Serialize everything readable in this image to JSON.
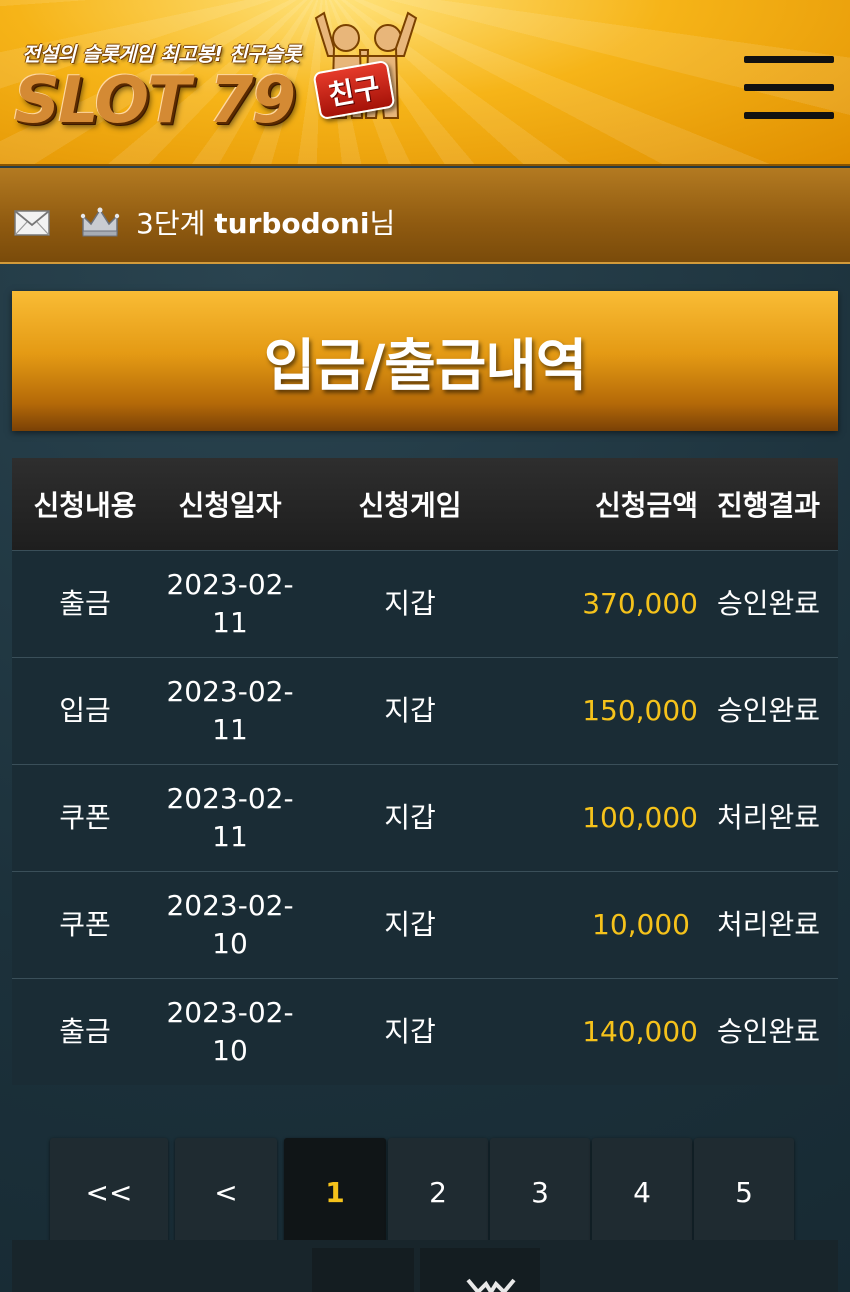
{
  "header": {
    "tagline": "전설의 슬롯게임 최고봉! 친구슬롯",
    "logo_text": "SLOT 79",
    "logo_badge": "친구",
    "menu_icon": "hamburger-menu-icon",
    "colors": {
      "primary": "#f6b418",
      "dark": "#8a5500"
    }
  },
  "userbar": {
    "mail_icon": "mail-icon",
    "crown_icon": "crown-icon",
    "level": "3단계",
    "username": "turbodoni",
    "suffix": "님"
  },
  "title": "입금/출금내역",
  "table": {
    "headers": [
      "신청내용",
      "신청일자",
      "신청게임",
      "신청금액",
      "진행결과"
    ],
    "rows": [
      {
        "type": "출금",
        "date_1": "2023-02-",
        "date_2": "11",
        "game": "지갑",
        "amount": "370,000",
        "result": "승인완료"
      },
      {
        "type": "입금",
        "date_1": "2023-02-",
        "date_2": "11",
        "game": "지갑",
        "amount": "150,000",
        "result": "승인완료"
      },
      {
        "type": "쿠폰",
        "date_1": "2023-02-",
        "date_2": "11",
        "game": "지갑",
        "amount": "100,000",
        "result": "처리완료"
      },
      {
        "type": "쿠폰",
        "date_1": "2023-02-",
        "date_2": "10",
        "game": "지갑",
        "amount": "10,000",
        "result": "처리완료"
      },
      {
        "type": "출금",
        "date_1": "2023-02-",
        "date_2": "10",
        "game": "지갑",
        "amount": "140,000",
        "result": "승인완료"
      }
    ],
    "colors": {
      "amount": "#f5c21b"
    }
  },
  "pagination": {
    "first": "<<",
    "prev": "<",
    "pages": [
      "1",
      "2",
      "3",
      "4",
      "5"
    ],
    "current": "1"
  }
}
